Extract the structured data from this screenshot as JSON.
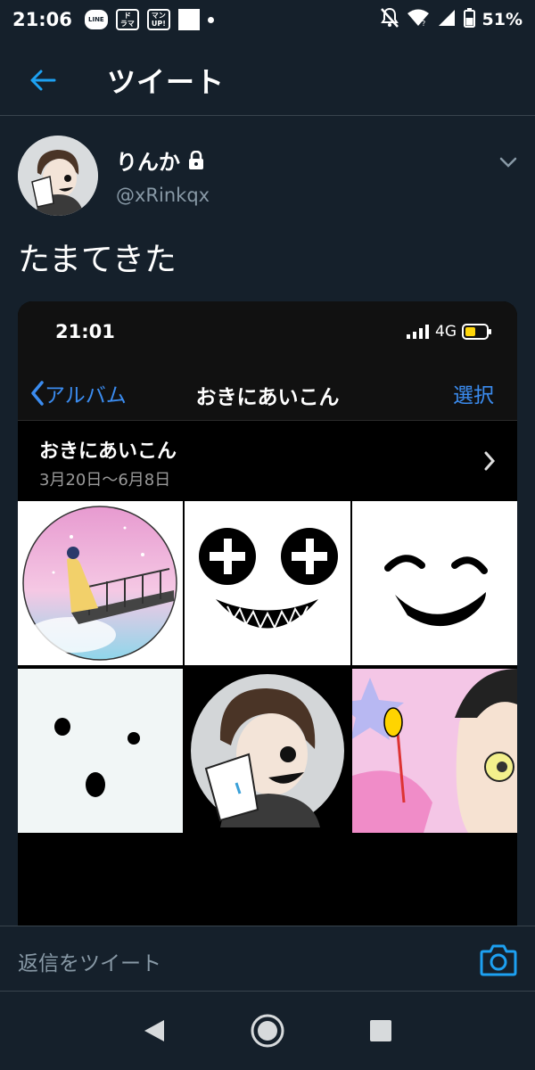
{
  "status_bar": {
    "time": "21:06",
    "notif_line": "LINE",
    "notif_drama": "ド\nラマ",
    "notif_manga": "マン\nUP!",
    "battery_percent": "51%"
  },
  "header": {
    "title": "ツイート",
    "accent_color": "#1da1f2"
  },
  "tweet": {
    "author_name": "りんか",
    "author_handle": "@xRinkqx",
    "text": "たまてきた"
  },
  "embedded_screenshot": {
    "time": "21:01",
    "network": "4G",
    "back_label": "アルバム",
    "title": "おきにあいこん",
    "select_label": "選択",
    "album_name": "おきにあいこん",
    "album_dates": "3月20日〜6月8日",
    "thumbnails": [
      "pink-sky-girl-balcony",
      "cross-eyes-grin",
      "smile-face",
      "dot-face",
      "masked-boy-avatar",
      "pink-star-boy"
    ]
  },
  "reply": {
    "placeholder": "返信をツイート"
  }
}
